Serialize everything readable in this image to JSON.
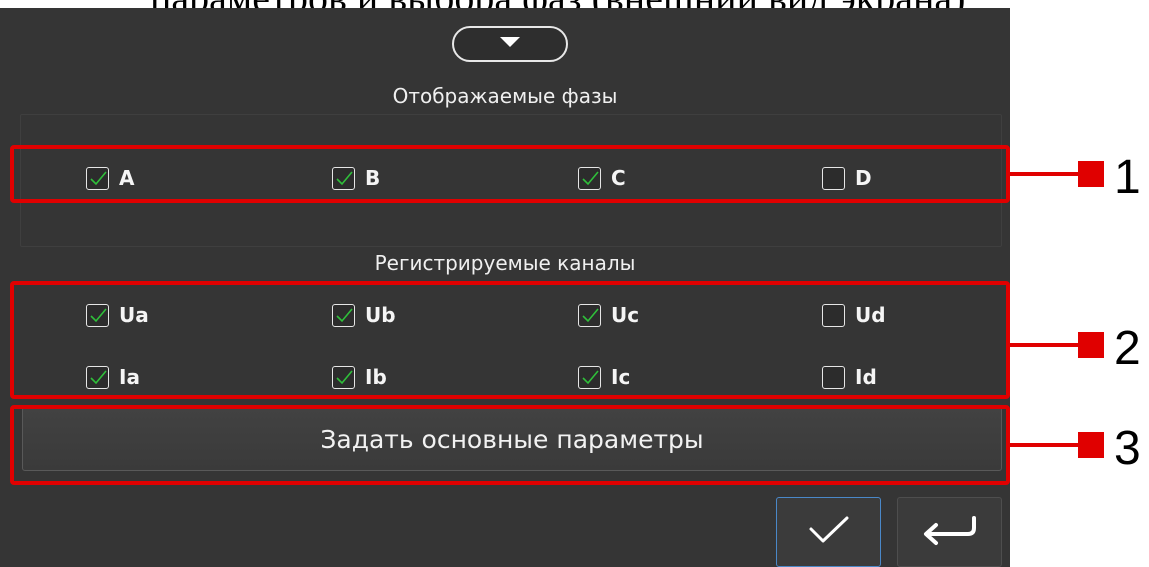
{
  "caption_fragment": "параметров и выбора фаз (внешний вид экрана)",
  "phases": {
    "title": "Отображаемые фазы",
    "items": [
      {
        "label": "A",
        "checked": true
      },
      {
        "label": "B",
        "checked": true
      },
      {
        "label": "C",
        "checked": true
      },
      {
        "label": "D",
        "checked": false
      }
    ]
  },
  "channels": {
    "title": "Регистрируемые каналы",
    "row1": [
      {
        "label": "Ua",
        "checked": true
      },
      {
        "label": "Ub",
        "checked": true
      },
      {
        "label": "Uc",
        "checked": true
      },
      {
        "label": "Ud",
        "checked": false
      }
    ],
    "row2": [
      {
        "label": "Ia",
        "checked": true
      },
      {
        "label": "Ib",
        "checked": true
      },
      {
        "label": "Ic",
        "checked": true
      },
      {
        "label": "Id",
        "checked": false
      }
    ]
  },
  "main_button": {
    "label": "Задать основные параметры"
  },
  "icons": {
    "collapse": "chevron-down-icon",
    "ok": "check-icon",
    "back": "return-arrow-icon",
    "checkbox_mark": "check-icon"
  },
  "annotations": {
    "markers": [
      "1",
      "2",
      "3"
    ]
  },
  "colors": {
    "panel_bg": "#353535",
    "check_green": "#2fbf3a",
    "annotation_red": "#e00000",
    "ok_border": "#4a88c8"
  }
}
